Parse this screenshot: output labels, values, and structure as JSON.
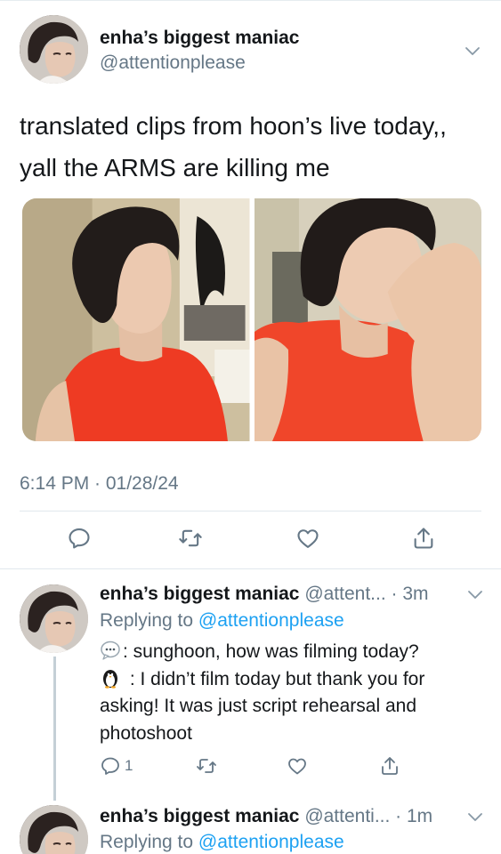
{
  "tweet": {
    "author_name": "enha’s biggest maniac",
    "author_handle": "@attentionplease",
    "text_lines": [
      "translated clips from hoon’s live today,,",
      "yall the ARMS are killing me"
    ],
    "timestamp": "6:14 PM · 01/28/24",
    "media": [
      {
        "icon": "photo-left",
        "shirt_color": "#ef3b24"
      },
      {
        "icon": "photo-right",
        "shirt_color": "#f0462a"
      }
    ],
    "actions": [
      "reply-icon",
      "retweet-icon",
      "like-icon",
      "share-icon"
    ]
  },
  "replies": [
    {
      "author_name": "enha’s biggest maniac",
      "meta": "@attent... · 3m",
      "replying_prefix": "Replying to",
      "replying_handle": "@attentionplease",
      "body_lines": [
        ": sunghoon, how was filming today?",
        " : I didn’t film today but thank you for",
        "asking! It was just script rehearsal and",
        "photoshoot"
      ],
      "reply_count": "1"
    },
    {
      "author_name": "enha’s biggest maniac",
      "meta": "@attenti... · 1m",
      "replying_prefix": "Replying to",
      "replying_handle": "@attentionplease"
    }
  ],
  "colors": {
    "link": "#1da1f2",
    "secondary_text": "#657786",
    "primary_text": "#14171a",
    "divider": "#e1e8ed"
  }
}
